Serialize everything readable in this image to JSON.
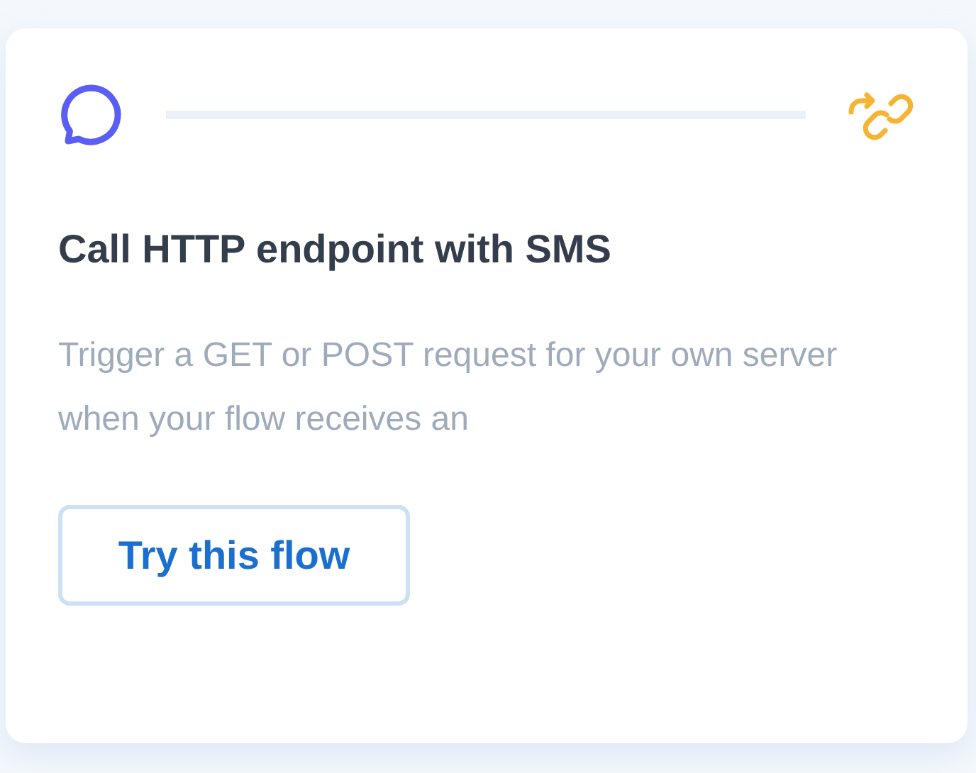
{
  "card": {
    "title": "Call HTTP endpoint with SMS",
    "description": "Trigger a GET or POST request for your own server when your flow receives an",
    "button": "Try this flow"
  }
}
